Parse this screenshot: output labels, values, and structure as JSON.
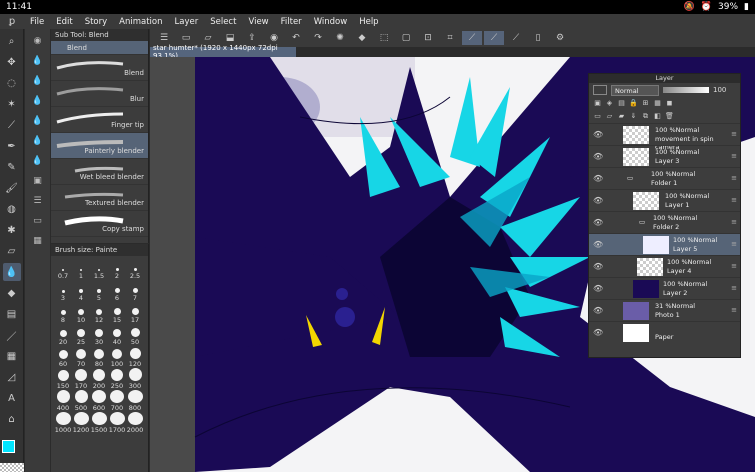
{
  "status": {
    "time": "11:41",
    "battery": "39%"
  },
  "menu": [
    "File",
    "Edit",
    "Story",
    "Animation",
    "Layer",
    "Select",
    "View",
    "Filter",
    "Window",
    "Help"
  ],
  "subtool": {
    "title": "Sub Tool: Blend",
    "group": "Blend",
    "items": [
      "Blend",
      "Blur",
      "Finger tip",
      "Painterly blender",
      "Wet bleed blender",
      "Textured blender",
      "Copy stamp"
    ],
    "selected": "Painterly blender"
  },
  "brushsize": {
    "title": "Brush size: Painte",
    "sizes": [
      "0.7",
      "1",
      "1.5",
      "2",
      "2.5",
      "3",
      "4",
      "5",
      "6",
      "7",
      "8",
      "10",
      "12",
      "15",
      "17",
      "20",
      "25",
      "30",
      "40",
      "50",
      "60",
      "70",
      "80",
      "100",
      "120",
      "150",
      "170",
      "200",
      "250",
      "300",
      "400",
      "500",
      "600",
      "700",
      "800",
      "1000",
      "1200",
      "1500",
      "1700",
      "2000"
    ]
  },
  "document": {
    "tab": "star humter* (1920 x 1440px 72dpi 93.1%)"
  },
  "layer_panel": {
    "title": "Layer",
    "blend_mode": "Normal",
    "opacity": "100",
    "layers": [
      {
        "percent": "100 %Normal",
        "name": "movement in spin camera"
      },
      {
        "percent": "100 %Normal",
        "name": "Layer 3"
      },
      {
        "percent": "100 %Normal",
        "name": "Folder 1"
      },
      {
        "percent": "100 %Normal",
        "name": "Layer 1"
      },
      {
        "percent": "100 %Normal",
        "name": "Folder 2"
      },
      {
        "percent": "100 %Normal",
        "name": "Layer 5"
      },
      {
        "percent": "100 %Normal",
        "name": "Layer 4"
      },
      {
        "percent": "100 %Normal",
        "name": "Layer 2"
      },
      {
        "percent": "31 %Normal",
        "name": "Photo 1"
      },
      {
        "percent": "",
        "name": "Paper"
      }
    ]
  },
  "colors": {
    "main": "#00e5ff",
    "sub": "#e02020"
  }
}
